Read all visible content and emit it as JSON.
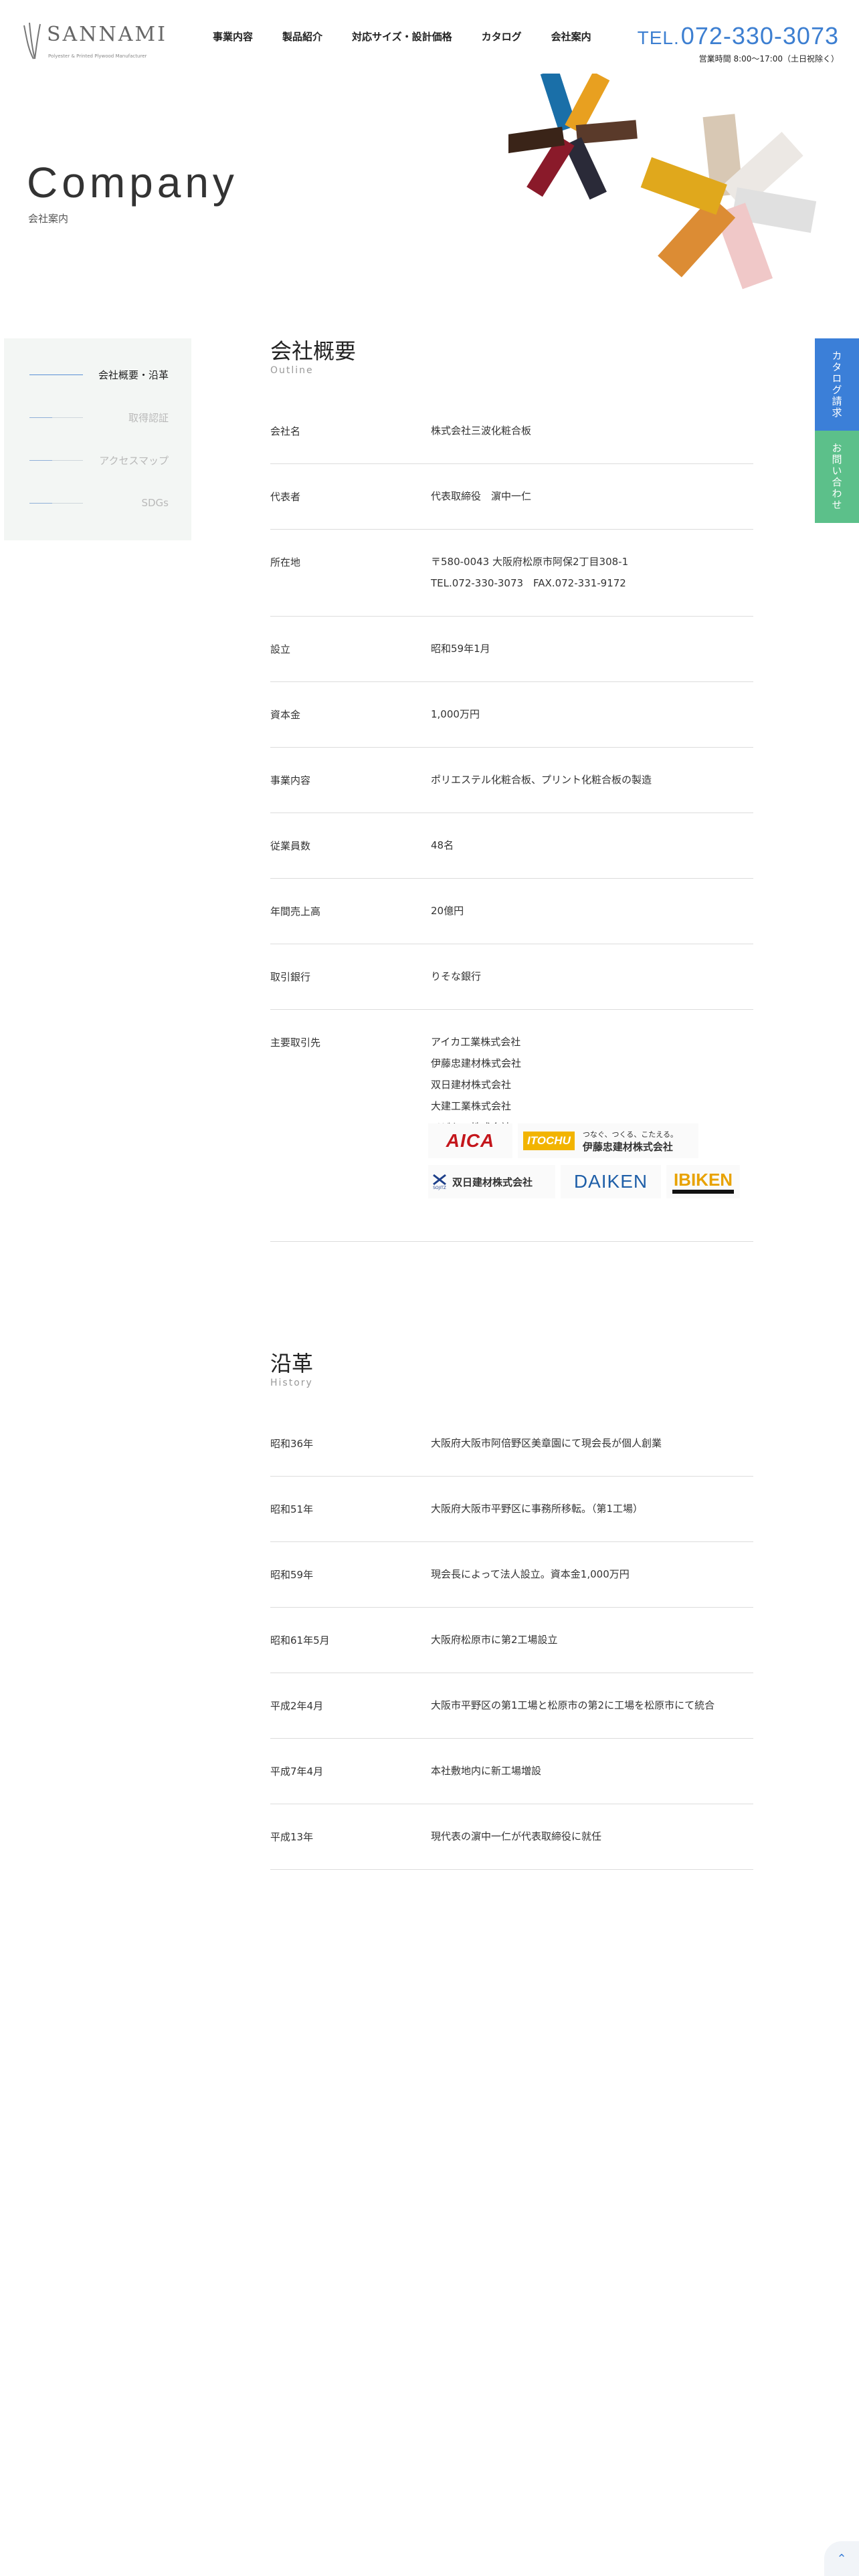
{
  "brand": {
    "name": "SANNAMI",
    "tagline": "Polyester & Printed Plywood Manufacturer"
  },
  "nav": [
    "事業内容",
    "製品紹介",
    "対応サイズ・設計価格",
    "カタログ",
    "会社案内"
  ],
  "contact": {
    "tel_prefix": "TEL.",
    "tel_number": "072-330-3073",
    "hours": "営業時間 8:00〜17:00（土日祝除く）"
  },
  "hero": {
    "title": "Company",
    "subtitle": "会社案内"
  },
  "sidenav": [
    {
      "label": "会社概要・沿革",
      "active": true
    },
    {
      "label": "取得認証",
      "active": false
    },
    {
      "label": "アクセスマップ",
      "active": false
    },
    {
      "label": "SDGs",
      "active": false
    }
  ],
  "side_tabs": {
    "catalog": "カタログ請求",
    "contact": "お問い合わせ"
  },
  "outline": {
    "title": "会社概要",
    "en": "Outline",
    "rows": [
      {
        "label": "会社名",
        "values": [
          "株式会社三波化粧合板"
        ]
      },
      {
        "label": "代表者",
        "values": [
          "代表取締役　濵中一仁"
        ]
      },
      {
        "label": "所在地",
        "values": [
          "〒580-0043 大阪府松原市阿保2丁目308-1",
          "TEL.072-330-3073　FAX.072-331-9172"
        ]
      },
      {
        "label": "設立",
        "values": [
          "昭和59年1月"
        ]
      },
      {
        "label": "資本金",
        "values": [
          "1,000万円"
        ]
      },
      {
        "label": "事業内容",
        "values": [
          "ポリエステル化粧合板、プリント化粧合板の製造"
        ]
      },
      {
        "label": "従業員数",
        "values": [
          "48名"
        ]
      },
      {
        "label": "年間売上高",
        "values": [
          "20億円"
        ]
      },
      {
        "label": "取引銀行",
        "values": [
          "りそな銀行"
        ]
      },
      {
        "label": "主要取引先",
        "values": [
          "アイカ工業株式会社",
          "伊藤忠建材株式会社",
          "双日建材株式会社",
          "大建工業株式会社",
          "イビケン株式会社"
        ]
      }
    ],
    "partner_logos": {
      "aica": "AICA",
      "itochu": "ITOCHU",
      "itochu_tagline": "つなぐ、つくる、こたえる。",
      "itochu_name": "伊藤忠建材株式会社",
      "sojitz_name": "双日建材株式会社",
      "sojitz_mark": "SOJITZ",
      "daiken": "DAIKEN",
      "ibiken": "IBIKEN"
    }
  },
  "history": {
    "title": "沿革",
    "en": "History",
    "rows": [
      {
        "label": "昭和36年",
        "value": "大阪府大阪市阿倍野区美章園にて現会長が個人創業"
      },
      {
        "label": "昭和51年",
        "value": "大阪府大阪市平野区に事務所移転。（第1工場）"
      },
      {
        "label": "昭和59年",
        "value": "現会長によって法人設立。資本金1,000万円"
      },
      {
        "label": "昭和61年5月",
        "value": "大阪府松原市に第2工場設立"
      },
      {
        "label": "平成2年4月",
        "value": "大阪市平野区の第1工場と松原市の第2に工場を松原市にて統合"
      },
      {
        "label": "平成7年4月",
        "value": "本社敷地内に新工場増設"
      },
      {
        "label": "平成13年",
        "value": "現代表の濵中一仁が代表取締役に就任"
      }
    ]
  },
  "colors": {
    "accent_blue": "#3b7fd8",
    "accent_green": "#5cc08a",
    "sidebar_bg": "#f3f6f4"
  }
}
